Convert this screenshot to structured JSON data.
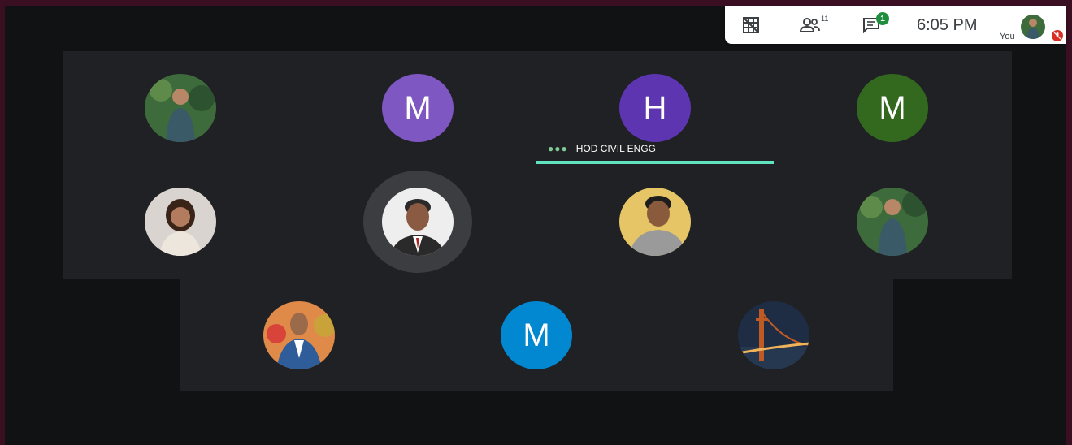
{
  "toolbar": {
    "participants_count": "11",
    "chat_badge": "1",
    "clock": "6:05 PM",
    "you_label": "You",
    "icons": [
      "grid-layout-icon",
      "people-icon",
      "chat-icon",
      "mic-off-icon"
    ]
  },
  "speaker_label": {
    "name": "HOD CIVIL ENGG"
  },
  "participants": [
    {
      "type": "photo",
      "palette": [
        "#3d6b3b",
        "#b88768",
        "#3b5a68"
      ]
    },
    {
      "type": "letter",
      "letter": "M",
      "color": "#7e57c2"
    },
    {
      "type": "letter",
      "letter": "H",
      "color": "#5e35b1"
    },
    {
      "type": "letter",
      "letter": "M",
      "color": "#33691e"
    },
    {
      "type": "photo",
      "palette": [
        "#d9d4cf",
        "#8a5a45",
        "#ece6dc"
      ]
    },
    {
      "type": "photo",
      "palette": [
        "#eeeeee",
        "#8b5a43",
        "#2a2a2a"
      ]
    },
    {
      "type": "photo",
      "palette": [
        "#e6c566",
        "#8a5a3c",
        "#9a9a9a"
      ]
    },
    {
      "type": "photo",
      "palette": [
        "#3d6b3b",
        "#b88768",
        "#3b5a68"
      ]
    },
    {
      "type": "photo",
      "palette": [
        "#e08a4a",
        "#9b6a4a",
        "#2f5d99"
      ]
    },
    {
      "type": "letter",
      "letter": "M",
      "color": "#0288d1"
    },
    {
      "type": "photo",
      "palette": [
        "#1f2d44",
        "#c05a24",
        "#f0b35a"
      ]
    }
  ],
  "colors": {
    "speaking_bar": "#61e2c1",
    "tile_bg": "#202124",
    "frame_bg": "#111214"
  }
}
